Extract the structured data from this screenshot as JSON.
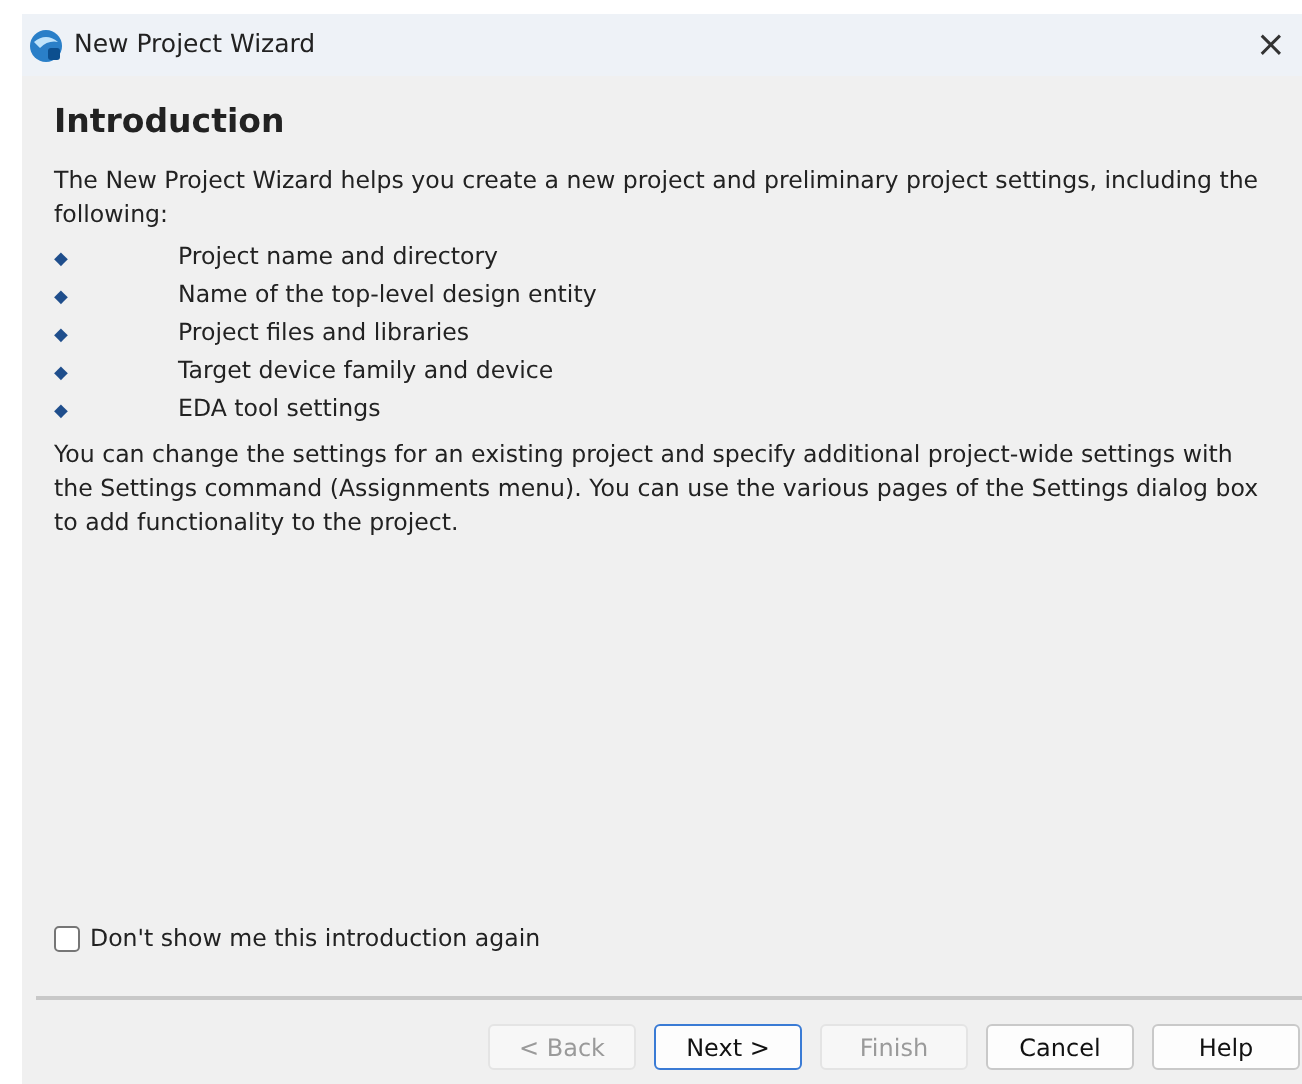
{
  "window": {
    "title": "New Project Wizard",
    "close": "×"
  },
  "heading": "Introduction",
  "intro": "The New Project Wizard helps you create a new project and preliminary project settings, including the following:",
  "bullets": [
    {
      "bullet": "◆",
      "text": "Project name and directory"
    },
    {
      "bullet": "◆",
      "text": "Name of the top-level design entity"
    },
    {
      "bullet": "◆",
      "text": "Project files and libraries"
    },
    {
      "bullet": "◆",
      "text": "Target device family and device"
    },
    {
      "bullet": "◆",
      "text": "EDA tool settings"
    }
  ],
  "note": "You can change the settings for an existing project and specify additional project-wide settings with the Settings command (Assignments menu). You can use the various pages of the Settings dialog box to add functionality to the project.",
  "dont_show": {
    "label": "Don't show me this introduction again",
    "checked": false
  },
  "buttons": [
    {
      "label": "< Back",
      "disabled": true,
      "default": false
    },
    {
      "label": "Next >",
      "disabled": false,
      "default": true
    },
    {
      "label": "Finish",
      "disabled": true,
      "default": false
    },
    {
      "label": "Cancel",
      "disabled": false,
      "default": false
    },
    {
      "label": "Help",
      "disabled": false,
      "default": false
    }
  ]
}
